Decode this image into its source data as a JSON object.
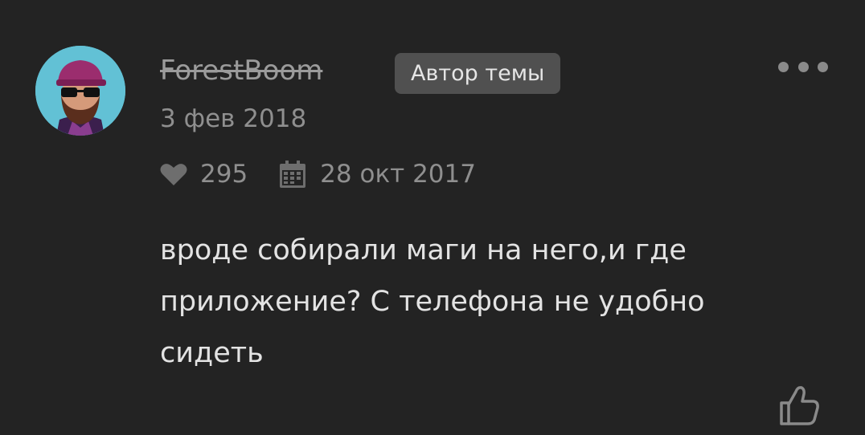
{
  "post": {
    "author": {
      "username": "ForestBoom",
      "badge": "Автор темы",
      "avatar_icon": "avatar-bearded-man-cap-sunglasses"
    },
    "date": "3 фев 2018",
    "stats": {
      "likes": "295",
      "joined": "28 окт 2017"
    },
    "message": "вроде собирали маги на него,и где приложение? С телефона не удобно сидеть"
  },
  "icons": {
    "more": "more-dots-icon",
    "heart": "heart-icon",
    "calendar": "calendar-icon",
    "like": "thumbs-up-icon"
  },
  "colors": {
    "background": "#232323",
    "avatar_bg": "#62c1d5",
    "badge_bg": "#505050",
    "muted_text": "#8f8f8f",
    "body_text": "#e3e3e3"
  }
}
